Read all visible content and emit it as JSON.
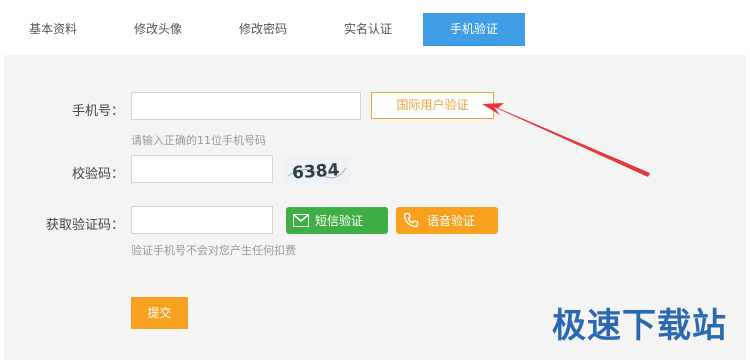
{
  "tabs": [
    {
      "label": "基本资料"
    },
    {
      "label": "修改头像"
    },
    {
      "label": "修改密码"
    },
    {
      "label": "实名认证"
    },
    {
      "label": "手机验证"
    }
  ],
  "form": {
    "phone_label": "手机号：",
    "phone_value": "",
    "intl_button": "国际用户验证",
    "phone_hint": "请输入正确的11位手机号码",
    "captcha_label": "校验码：",
    "captcha_value": "",
    "captcha_text": "6384",
    "code_label": "获取验证码：",
    "code_value": "",
    "sms_button": "短信验证",
    "voice_button": "语音验证",
    "code_hint": "验证手机号不会对您产生任何扣费",
    "submit_button": "提交"
  },
  "watermark": "极速下载站",
  "colors": {
    "active_tab": "#3f9ee6",
    "orange": "#f7a11f",
    "green": "#3fae44",
    "arrow": "#e8363a",
    "watermark": "#2a68b1"
  },
  "icons": {
    "sms": "envelope-icon",
    "voice": "phone-icon"
  }
}
